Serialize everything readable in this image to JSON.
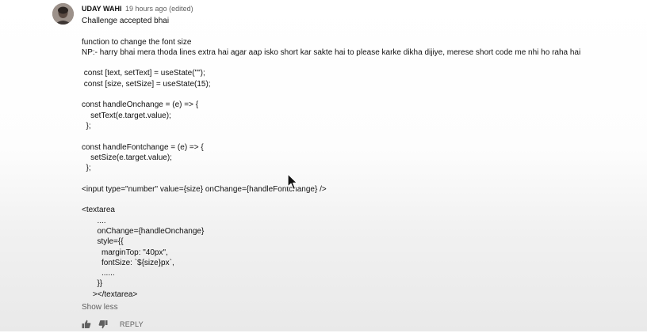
{
  "comment": {
    "author": "UDAY WAHI",
    "timestamp": "19 hours ago (edited)",
    "lines": [
      "Challenge accepted bhai",
      "",
      "function to change the font size",
      "NP:- harry bhai mera thoda lines extra hai agar aap isko short kar sakte hai to please karke dikha dijiye, merese short code me nhi ho raha hai",
      "",
      " const [text, setText] = useState(\"\");",
      " const [size, setSize] = useState(15);",
      "",
      "const handleOnchange = (e) => {",
      "    setText(e.target.value);",
      "  };",
      "",
      "const handleFontchange = (e) => {",
      "    setSize(e.target.value);",
      "  };",
      "",
      "<input type=\"number\" value={size} onChange={handleFontchange} />",
      "",
      "<textarea",
      "       ....",
      "       onChange={handleOnchange}",
      "       style={{",
      "         marginTop: \"40px\",",
      "         fontSize: `${size}px`,",
      "         ......",
      "       }}",
      "     ></textarea>"
    ],
    "show_less_label": "Show less",
    "reply_label": "REPLY"
  },
  "icons": {
    "like": "thumb-up-icon",
    "dislike": "thumb-down-icon",
    "pointer": "mouse-pointer-icon"
  }
}
